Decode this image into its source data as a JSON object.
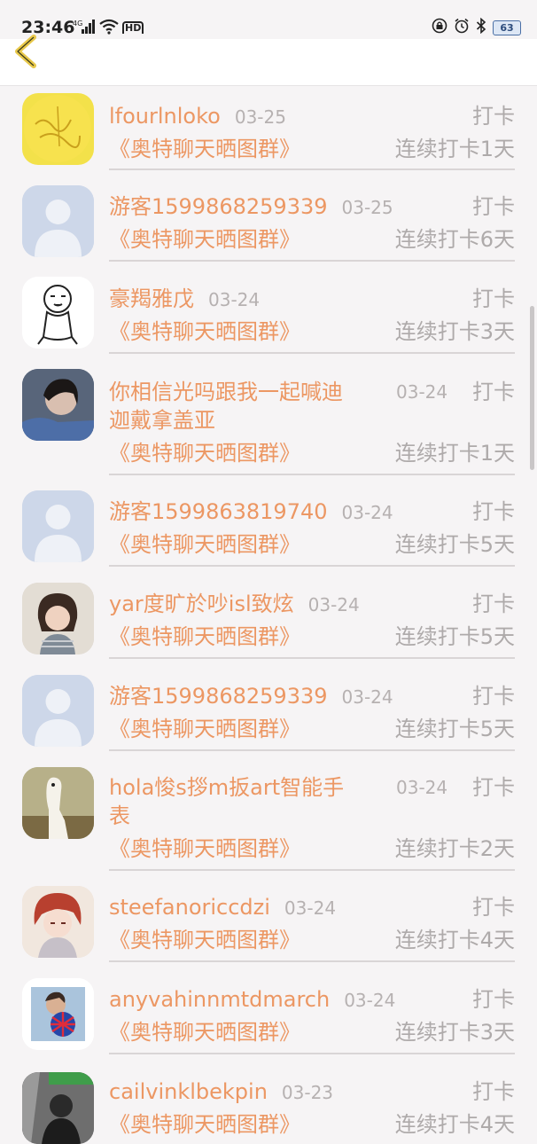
{
  "status_bar": {
    "time": "23:46",
    "signal_text": "4G",
    "hd_text": "HD",
    "battery": "63"
  },
  "header": {
    "back_icon": "chevron-left-icon"
  },
  "records": [
    {
      "name": "lfourlnloko",
      "date": "03-25",
      "group": "《奥特聊天晒图群》",
      "action": "打卡",
      "streak": "连续打卡1天",
      "avatar": "yellow-calligraphy"
    },
    {
      "name": "游客1599868259339",
      "date": "03-25",
      "group": "《奥特聊天晒图群》",
      "action": "打卡",
      "streak": "连续打卡6天",
      "avatar": "default"
    },
    {
      "name": "豪羯雅戊",
      "date": "03-24",
      "group": "《奥特聊天晒图群》",
      "action": "打卡",
      "streak": "连续打卡3天",
      "avatar": "tiger-sketch"
    },
    {
      "name_line1": "你相信光吗跟我一起喊迪",
      "name_line2": "迦戴拿盖亚",
      "date": "03-24",
      "group": "《奥特聊天晒图群》",
      "action": "打卡",
      "streak": "连续打卡1天",
      "avatar": "girl-photo"
    },
    {
      "name": "游客1599863819740",
      "date": "03-24",
      "group": "《奥特聊天晒图群》",
      "action": "打卡",
      "streak": "连续打卡5天",
      "avatar": "default"
    },
    {
      "name": "yar度旷於吵isl致炫",
      "date": "03-24",
      "group": "《奥特聊天晒图群》",
      "action": "打卡",
      "streak": "连续打卡5天",
      "avatar": "child-photo"
    },
    {
      "name": "游客1599868259339",
      "date": "03-24",
      "group": "《奥特聊天晒图群》",
      "action": "打卡",
      "streak": "连续打卡5天",
      "avatar": "default"
    },
    {
      "name_line1": "hola悛s拶m扳art智能手",
      "name_line2": "表",
      "date": "03-24",
      "group": "《奥特聊天晒图群》",
      "action": "打卡",
      "streak": "连续打卡2天",
      "avatar": "alpaca-photo"
    },
    {
      "name": "steefanoriccdzi",
      "date": "03-24",
      "group": "《奥特聊天晒图群》",
      "action": "打卡",
      "streak": "连续打卡4天",
      "avatar": "anime-redhair"
    },
    {
      "name": "anyvahinnmtdmarch",
      "date": "03-24",
      "group": "《奥特聊天晒图群》",
      "action": "打卡",
      "streak": "连续打卡3天",
      "avatar": "man-flowers"
    },
    {
      "name": "cailvinklbekpin",
      "date": "03-23",
      "group": "《奥特聊天晒图群》",
      "action": "打卡",
      "streak": "连续打卡4天",
      "avatar": "bw-photo"
    }
  ]
}
